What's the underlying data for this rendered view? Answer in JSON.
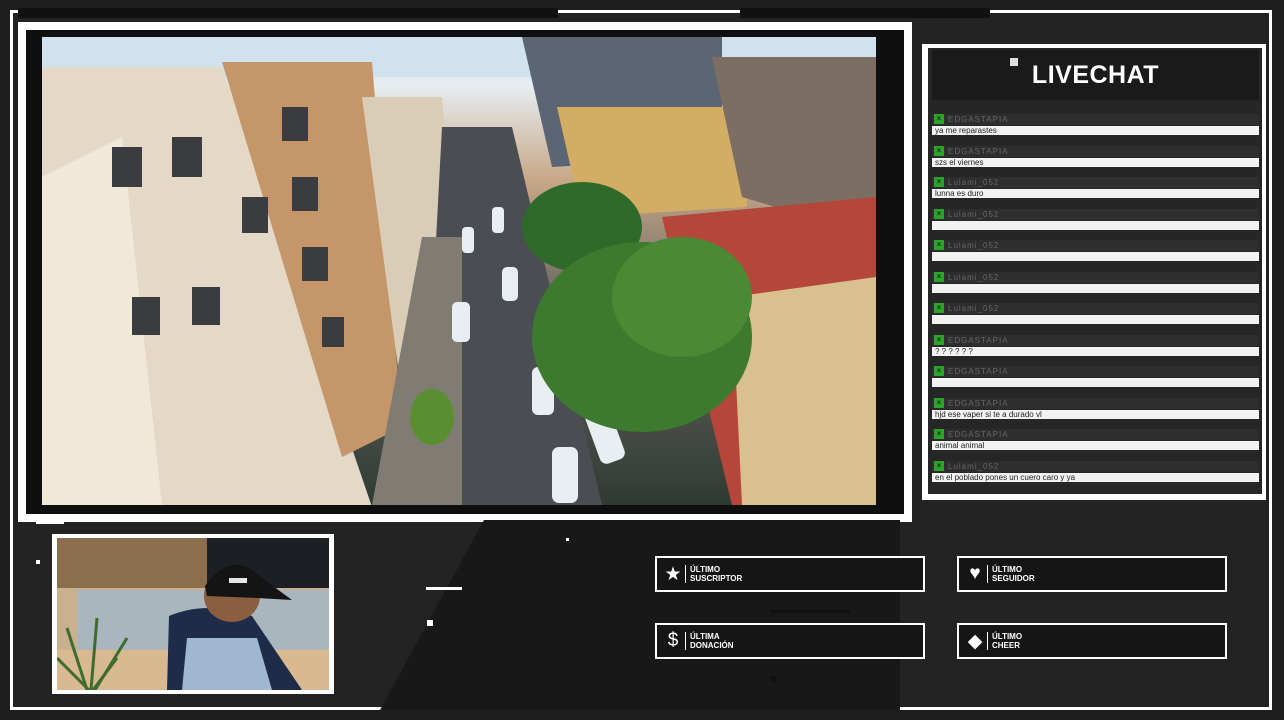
{
  "chat": {
    "title": "LIVECHAT",
    "messages": [
      {
        "user": "EDGASTAPIA",
        "text": "ya me reparastes"
      },
      {
        "user": "EDGASTAPIA",
        "text": "szs el viernes"
      },
      {
        "user": "Lulami_052",
        "text": "lunna es duro"
      },
      {
        "user": "Lulami_052",
        "text": ""
      },
      {
        "user": "Lulami_052",
        "text": ""
      },
      {
        "user": "Lulami_052",
        "text": ""
      },
      {
        "user": "Lulami_052",
        "text": ""
      },
      {
        "user": "EDGASTAPIA",
        "text": "? ? ? ? ? ?"
      },
      {
        "user": "EDGASTAPIA",
        "text": ""
      },
      {
        "user": "EDGASTAPIA",
        "text": "hjd ese vaper si te a durado vl"
      },
      {
        "user": "EDGASTAPIA",
        "text": "animal animal"
      },
      {
        "user": "Lulami_052",
        "text": "en el poblado pones un cuero caro y ya"
      }
    ]
  },
  "widgets": {
    "subscriber": {
      "line1": "ÚLTIMO",
      "line2": "SUSCRIPTOR",
      "icon": "star-icon"
    },
    "follower": {
      "line1": "ÚLTIMO",
      "line2": "SEGUIDOR",
      "icon": "heart-icon"
    },
    "donation": {
      "line1": "ÚLTIMA",
      "line2": "DONACIÓN",
      "icon": "dollar-icon"
    },
    "cheer": {
      "line1": "ÚLTIMO",
      "line2": "CHEER",
      "icon": "diamond-icon"
    }
  },
  "colors": {
    "background": "#1e1e1e",
    "frame": "#ffffff",
    "chat_badge": "#2aa52a"
  }
}
